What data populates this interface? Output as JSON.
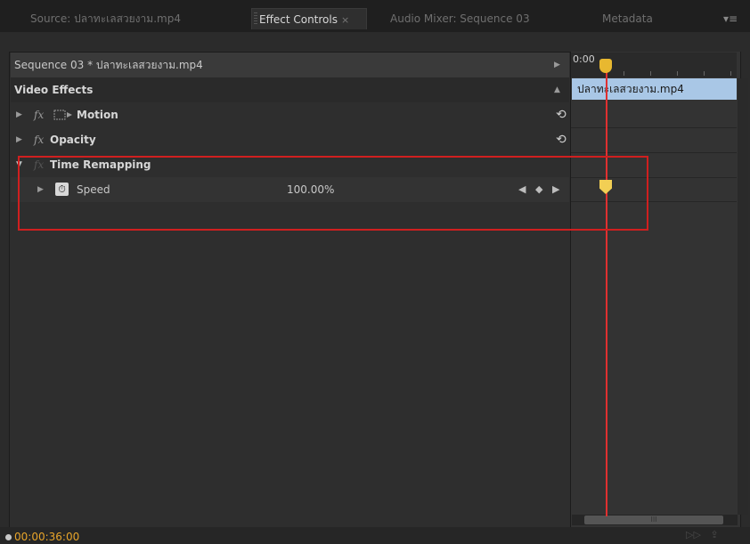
{
  "tabs": [
    {
      "label": "Source: ปลาทะเลสวยงาม.mp4",
      "active": false
    },
    {
      "label": "Effect Controls",
      "active": true,
      "close": "×"
    },
    {
      "label": "Audio Mixer: Sequence 03",
      "active": false
    },
    {
      "label": "Metadata",
      "active": false
    }
  ],
  "panel_menu_glyph": "▾≡",
  "header": {
    "sequence_label": "Sequence 03 * ปลาทะเลสวยงาม.mp4"
  },
  "effects": {
    "section_title": "Video Effects",
    "motion": {
      "label": "Motion",
      "fx": "fx"
    },
    "opacity": {
      "label": "Opacity",
      "fx": "fx"
    },
    "time_remapping": {
      "label": "Time Remapping",
      "fx": "fx"
    },
    "speed": {
      "label": "Speed",
      "value": "100.00%"
    }
  },
  "timeline": {
    "ruler_time": "0:00",
    "clip_name": "ปลาทะเลสวยงาม.mp4",
    "scroll_grip": "III"
  },
  "footer": {
    "timecode": "00:00:36:00"
  },
  "colors": {
    "accent": "#e8a52a",
    "playhead": "#e03030",
    "highlight": "#d01f1f",
    "clip": "#a9c7e6"
  }
}
